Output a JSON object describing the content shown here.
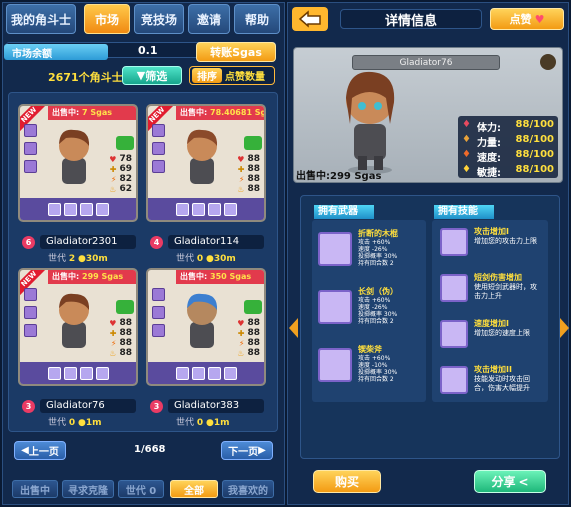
{
  "tabs": [
    {
      "label": "我的角斗士",
      "active": false
    },
    {
      "label": "市场",
      "active": true
    },
    {
      "label": "竞技场",
      "active": false
    },
    {
      "label": "邀请",
      "active": false
    },
    {
      "label": "帮助",
      "active": false
    }
  ],
  "market": {
    "balance_label": "市场余额",
    "balance_value": "0.1",
    "transfer_button": "转账Sgas",
    "count_text": "2671个角斗士",
    "filter_button": "筛选",
    "sort_label": "排序",
    "sort_value": "点赞数量"
  },
  "cards": [
    {
      "badge": "NEW",
      "price_prefix": "出售中:",
      "price": "7 Sgas",
      "stats": [
        "78",
        "69",
        "82",
        "62"
      ],
      "name": "Gladiator2301",
      "level": "6",
      "gen_label": "世代",
      "gen": "2",
      "time": "30m"
    },
    {
      "badge": "NEW",
      "price_prefix": "出售中:",
      "price": "78.40681 Sgas",
      "stats": [
        "88",
        "88",
        "88",
        "88"
      ],
      "name": "Gladiator114",
      "level": "4",
      "gen_label": "世代",
      "gen": "0",
      "time": "30m"
    },
    {
      "badge": "NEW",
      "price_prefix": "出售中:",
      "price": "299 Sgas",
      "stats": [
        "88",
        "88",
        "88",
        "88"
      ],
      "name": "Gladiator76",
      "level": "3",
      "gen_label": "世代",
      "gen": "0",
      "time": "1m"
    },
    {
      "badge": "",
      "price_prefix": "出售中:",
      "price": "350 Sgas",
      "stats": [
        "88",
        "88",
        "88",
        "88"
      ],
      "name": "Gladiator383",
      "level": "3",
      "gen_label": "世代",
      "gen": "0",
      "time": "1m"
    }
  ],
  "pagination": {
    "prev": "上一页",
    "page": "1/668",
    "next": "下一页"
  },
  "filter_tabs": [
    {
      "label": "出售中",
      "active": false
    },
    {
      "label": "寻求克隆",
      "active": false
    },
    {
      "label": "世代 0",
      "active": false
    },
    {
      "label": "全部",
      "active": true
    },
    {
      "label": "我喜欢的",
      "active": false
    }
  ],
  "detail": {
    "title": "详情信息",
    "like_button": "点赞",
    "gladiator_name": "Gladiator76",
    "price_text": "出售中:299 Sgas",
    "stats": [
      {
        "label": "体力:",
        "value": "88/100",
        "color": "#e84a5f"
      },
      {
        "label": "力量:",
        "value": "88/100",
        "color": "#e8a23a"
      },
      {
        "label": "速度:",
        "value": "88/100",
        "color": "#f06a2a"
      },
      {
        "label": "敏捷:",
        "value": "88/100",
        "color": "#ffd23a"
      }
    ],
    "weapons_header": "拥有武器",
    "skills_header": "拥有技能",
    "weapons": [
      {
        "name": "折断的木棍",
        "desc": "攻击 +60%\n速度 -26%\n投掷概率 30%\n持有回合数 2"
      },
      {
        "name": "长剑（伪）",
        "desc": "攻击 +60%\n速度 -26%\n投掷概率 30%\n持有回合数 2"
      },
      {
        "name": "锲柴斧",
        "desc": "攻击 +60%\n速度 -10%\n投掷概率 30%\n持有回合数 2"
      }
    ],
    "skills": [
      {
        "name": "攻击增加I",
        "desc": "增加您的攻击力上限"
      },
      {
        "name": "短剑伤害增加",
        "desc": "使用短剑武器时，攻击力上升"
      },
      {
        "name": "速度增加I",
        "desc": "增加您的速度上限"
      },
      {
        "name": "攻击增加II",
        "desc": "技能发动时攻击回合，伤害大幅提升"
      }
    ],
    "buy_button": "购买",
    "share_button": "分享"
  },
  "colors": {
    "accent": "#f39b13",
    "panel": "#12294c",
    "price_bar": "#e23a4c"
  }
}
